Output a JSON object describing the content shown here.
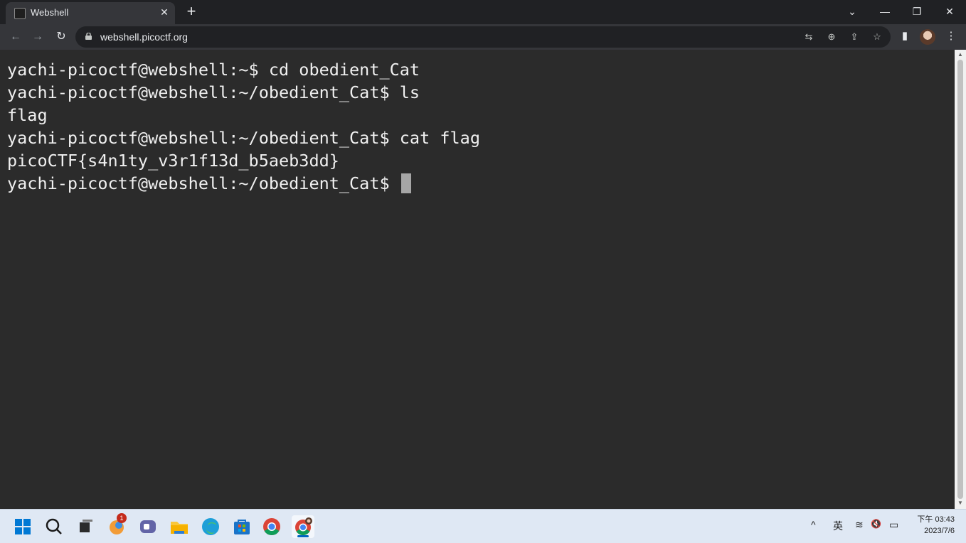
{
  "browser": {
    "tab_title": "Webshell",
    "tab_close": "✕",
    "new_tab": "+",
    "url": "webshell.picoctf.org",
    "window_controls": {
      "dropdown": "⌄",
      "minimize": "—",
      "restore": "❐",
      "close": "✕"
    },
    "nav": {
      "back": "←",
      "forward": "→",
      "reload": "↻"
    },
    "omnibox_icons": {
      "translate": "⇆",
      "zoom": "⊕",
      "share": "⇪",
      "bookmark": "☆"
    },
    "toolbar_icons": {
      "side_panel": "▮",
      "menu": "⋮"
    }
  },
  "terminal": {
    "lines": [
      "yachi-picoctf@webshell:~$ cd obedient_Cat",
      "yachi-picoctf@webshell:~/obedient_Cat$ ls",
      "flag",
      "yachi-picoctf@webshell:~/obedient_Cat$ cat flag",
      "picoCTF{s4n1ty_v3r1f13d_b5aeb3dd}",
      "yachi-picoctf@webshell:~/obedient_Cat$ "
    ]
  },
  "taskbar": {
    "notification_badge": "1",
    "tray": {
      "chevron": "^",
      "ime": "英",
      "wifi": "≋",
      "volume": "🔇",
      "battery": "▭"
    },
    "clock": {
      "time": "下午 03:43",
      "date": "2023/7/6"
    }
  },
  "colors": {
    "terminal_bg": "#2b2b2b",
    "terminal_fg": "#f0f0f0",
    "chrome_dark": "#202124",
    "toolbar": "#35363a",
    "taskbar": "#dfe8f4"
  }
}
